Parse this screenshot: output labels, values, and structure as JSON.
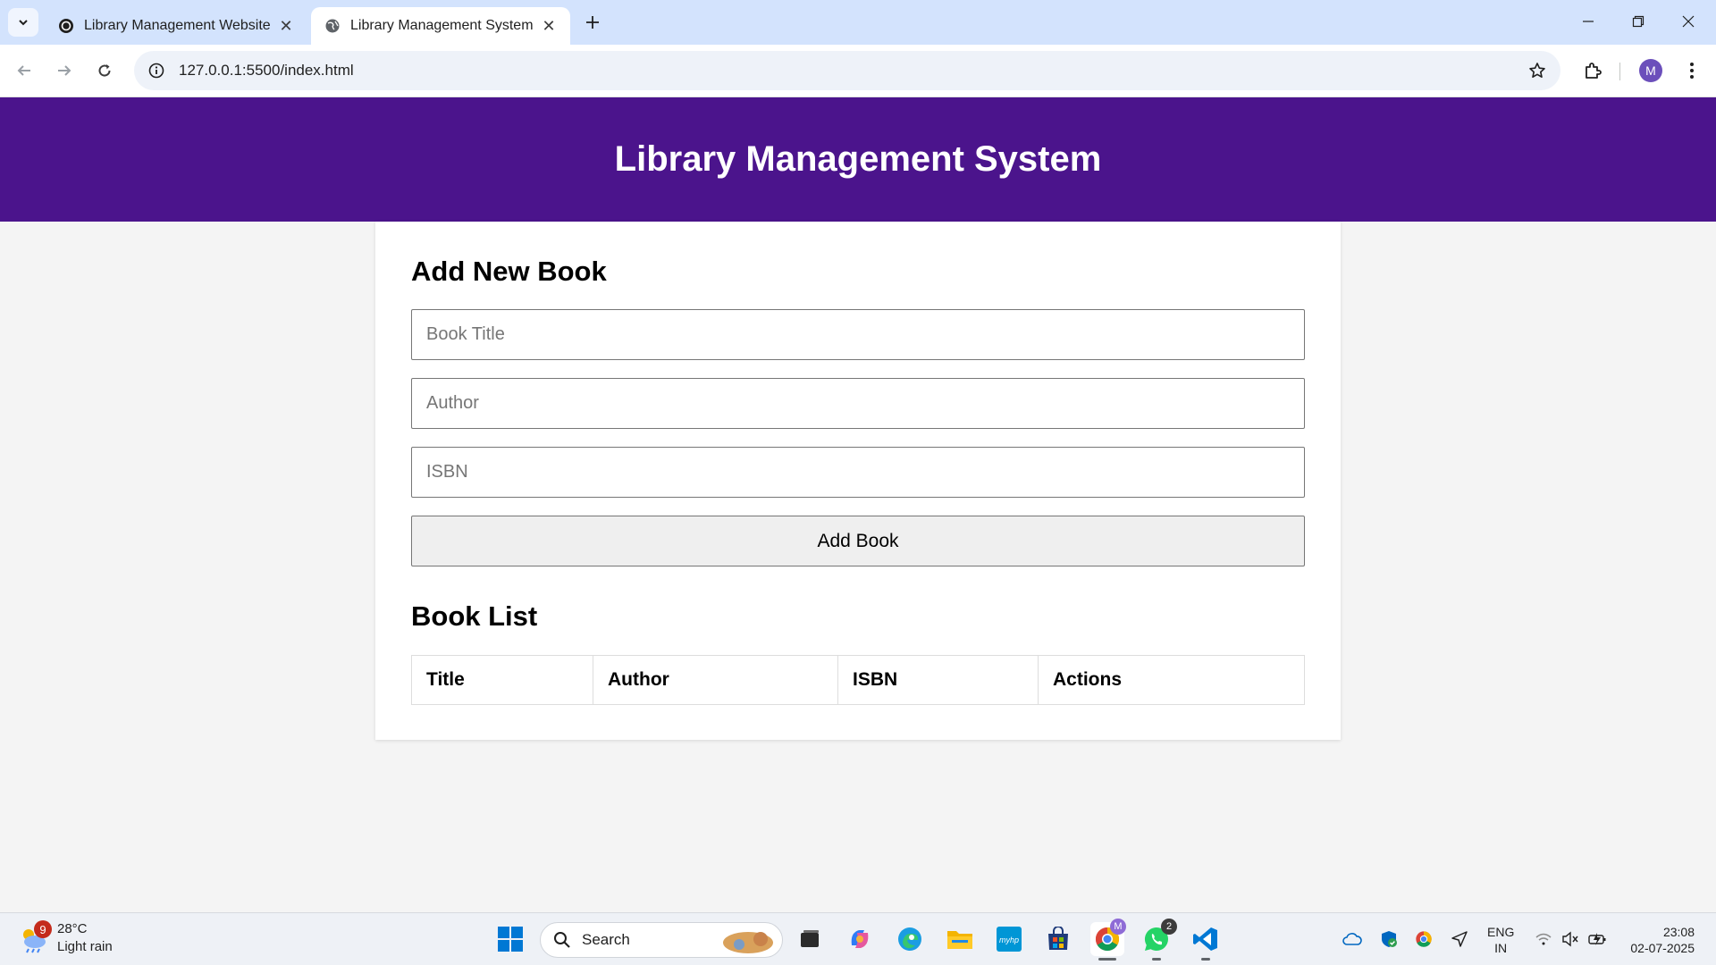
{
  "browser": {
    "tabs": [
      {
        "title": "Library Management Website",
        "active": false
      },
      {
        "title": "Library Management System",
        "active": true
      }
    ],
    "url": "127.0.0.1:5500/index.html",
    "profile_initial": "M",
    "accent_color": "#d3e3fd"
  },
  "page": {
    "header_title": "Library Management System",
    "header_color": "#4b148c",
    "add_section_title": "Add New Book",
    "inputs": {
      "title_placeholder": "Book Title",
      "author_placeholder": "Author",
      "isbn_placeholder": "ISBN"
    },
    "add_button_label": "Add Book",
    "list_section_title": "Book List",
    "table_headers": [
      "Title",
      "Author",
      "ISBN",
      "Actions"
    ],
    "rows": []
  },
  "taskbar": {
    "weather_badge": "9",
    "temperature": "28°C",
    "condition": "Light rain",
    "search_label": "Search",
    "whatsapp_badge": "2",
    "chrome_profile_badge": "M",
    "language_line1": "ENG",
    "language_line2": "IN",
    "time": "23:08",
    "date": "02-07-2025"
  }
}
